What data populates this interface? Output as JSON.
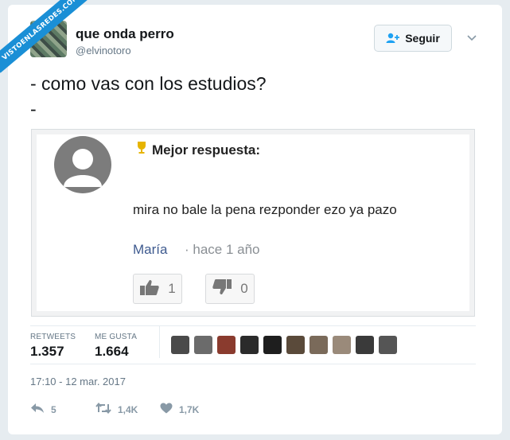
{
  "watermark": {
    "text": "VISTOENLASREDES.COM"
  },
  "author": {
    "display_name": "que onda perro",
    "handle": "@elvinotoro"
  },
  "follow_button": {
    "label": "Seguir"
  },
  "tweet": {
    "line1": "- como vas con los estudios?",
    "line2": "-"
  },
  "embedded_answer": {
    "title": "Mejor respuesta:",
    "text": "mira no bale la pena rezponder ezo ya pazo",
    "author": "María",
    "time": "· hace 1 año",
    "upvotes": "1",
    "downvotes": "0"
  },
  "stats": {
    "retweets_label": "RETWEETS",
    "retweets_value": "1.357",
    "likes_label": "ME GUSTA",
    "likes_value": "1.664"
  },
  "liker_avatar_colors": [
    "#4a4a4a",
    "#6b6b6b",
    "#8a3b2e",
    "#2b2b2b",
    "#1e1e1e",
    "#5a4a3a",
    "#7a6a5a",
    "#9a8a7a",
    "#3a3a3a",
    "#555555"
  ],
  "timestamp": "17:10 - 12 mar. 2017",
  "actions": {
    "reply_count": "5",
    "retweet_count": "1,4K",
    "like_count": "1,7K"
  },
  "colors": {
    "link_blue": "#1da1f2",
    "ribbon_blue": "#1a8fd6",
    "author_link": "#3e5a8f"
  }
}
